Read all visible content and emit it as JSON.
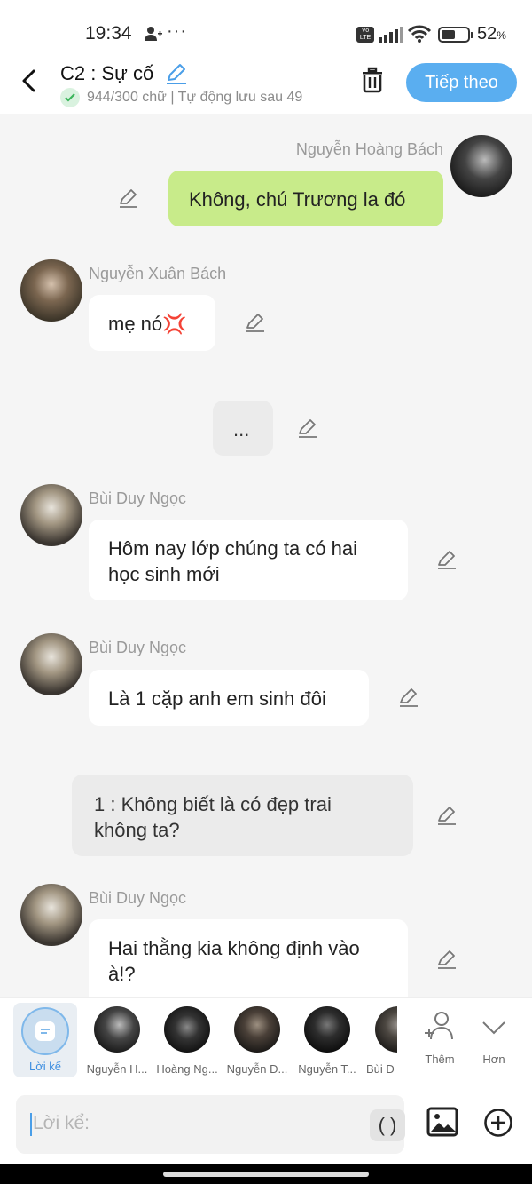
{
  "status_bar": {
    "time": "19:34",
    "dots": "···",
    "volte": "Vo LTE",
    "battery_level": 0.52,
    "battery_pct": "52",
    "pct_sign": "%"
  },
  "header": {
    "title": "C2 : Sự cố",
    "word_count": "944/300 chữ | Tự động lưu sau 49",
    "next_label": "Tiếp theo"
  },
  "messages": [
    {
      "sender": "Nguyễn Hoàng Bách",
      "text": "Không, chú Trương la đó"
    },
    {
      "sender": "Nguyễn Xuân Bách",
      "text": "mẹ nó💢"
    },
    {
      "text": "..."
    },
    {
      "sender": "Bùi Duy Ngọc",
      "text_l1": "Hôm nay lớp chúng ta có hai",
      "text_l2": "học sinh mới"
    },
    {
      "sender": "Bùi Duy Ngọc",
      "text": "Là 1 cặp anh em sinh đôi"
    },
    {
      "text_l1": "1 : Không biết là có đẹp trai",
      "text_l2": "không ta?"
    },
    {
      "sender": "Bùi Duy Ngọc",
      "text_l1": "Hai thằng kia không định vào",
      "text_l2": "à!?"
    }
  ],
  "characters": {
    "narration_label": "Lời kể",
    "items": [
      "Nguyễn H...",
      "Hoàng Ng...",
      "Nguyễn D...",
      "Nguyễn T...",
      "Bùi D"
    ],
    "add_label": "Thêm",
    "more_label": "Hơn"
  },
  "input": {
    "placeholder": "Lời kể:",
    "paren_label": "( )"
  },
  "colors": {
    "accent": "#5aaef0",
    "right_bubble": "#c8eb8a",
    "narration_bubble": "#ebebeb"
  },
  "icons": [
    "person-plus-icon",
    "signal-icon",
    "wifi-icon",
    "battery-icon",
    "back-arrow-icon",
    "edit-pencil-icon",
    "check-icon",
    "trash-icon",
    "narration-icon",
    "add-character-icon",
    "chevron-down-icon",
    "image-icon",
    "plus-circle-icon"
  ]
}
